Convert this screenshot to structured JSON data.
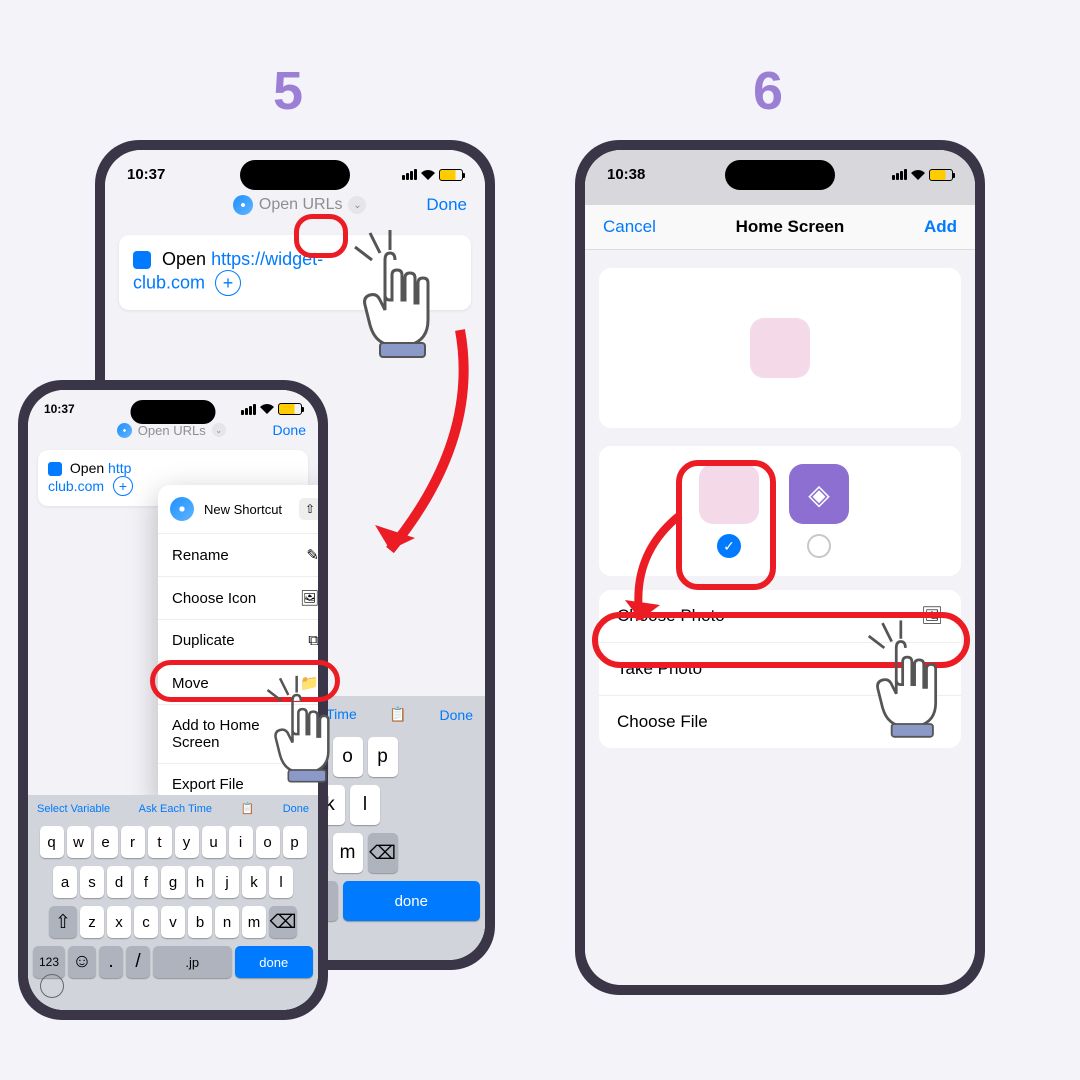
{
  "steps": {
    "five": "5",
    "six": "6"
  },
  "status": {
    "time1": "10:37",
    "time2": "10:38"
  },
  "p5a": {
    "title": "Open URLs",
    "done": "Done",
    "open": "Open",
    "url1": "https://widget-",
    "url2": "club.com",
    "selectVar": "Select Variable",
    "askEach": "Ask Each Time",
    "kbDone": "Done"
  },
  "p5b": {
    "menuTitle": "New Shortcut",
    "rename": "Rename",
    "chooseIcon": "Choose Icon",
    "duplicate": "Duplicate",
    "move": "Move",
    "addHome": "Add to Home Screen",
    "exportFile": "Export File",
    "time": "Time",
    "done": "Done",
    "kbDone": "done",
    "jp": ".jp",
    "num123": "123"
  },
  "p6": {
    "cancel": "Cancel",
    "title": "Home Screen",
    "add": "Add",
    "choosePhoto": "Choose Photo",
    "takePhoto": "Take Photo",
    "chooseFile": "Choose File"
  },
  "kb": {
    "r1": [
      "q",
      "w",
      "e",
      "r",
      "t",
      "y",
      "u",
      "i",
      "o",
      "p"
    ],
    "r2": [
      "a",
      "s",
      "d",
      "f",
      "g",
      "h",
      "j",
      "k",
      "l"
    ],
    "r3": [
      "z",
      "x",
      "c",
      "v",
      "b",
      "n",
      "m"
    ],
    "r4": [
      ".",
      "/"
    ]
  },
  "colors": {
    "accent": "#007aff",
    "ring": "#ec1c24",
    "step": "#9b7fd4"
  }
}
